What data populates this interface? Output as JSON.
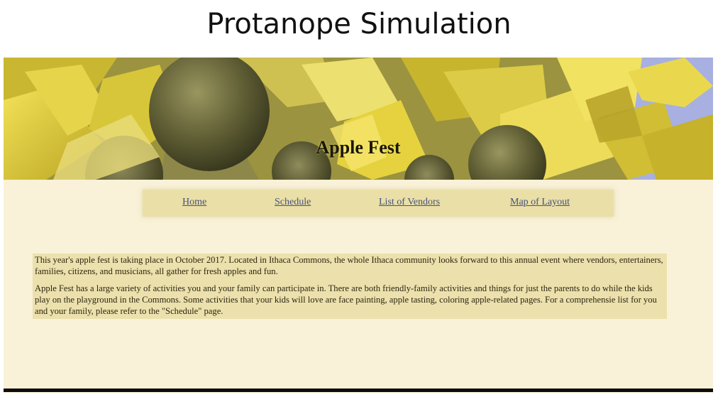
{
  "header": {
    "title": "Protanope Simulation"
  },
  "site": {
    "banner_title": "Apple Fest",
    "nav": [
      {
        "label": "Home"
      },
      {
        "label": "Schedule"
      },
      {
        "label": "List of Vendors"
      },
      {
        "label": "Map of Layout"
      }
    ],
    "paragraphs": [
      "This year's apple fest is taking place in October 2017. Located in Ithaca Commons, the whole Ithaca community looks forward to this annual event where vendors, entertainers, families, citizens, and musicians, all gather for fresh apples and fun.",
      "Apple Fest has a large variety of activities you and your family can participate in. There are both friendly-family activities and things for just the parents to do while the kids play on the playground in the Commons. Some activities that your kids will love are face painting, apple tasting, coloring apple-related pages. For a comprehensie list for you and your family, please refer to the \"Schedule\" page."
    ]
  },
  "colors": {
    "page_background": "#f9f1d8",
    "nav_background": "#eadfa6",
    "content_background": "#ece0ad",
    "link_color": "#45527a",
    "banner_foliage": "#d6c430",
    "banner_fruit": "#6b6a3a",
    "banner_sky": "#a7b0e0"
  }
}
